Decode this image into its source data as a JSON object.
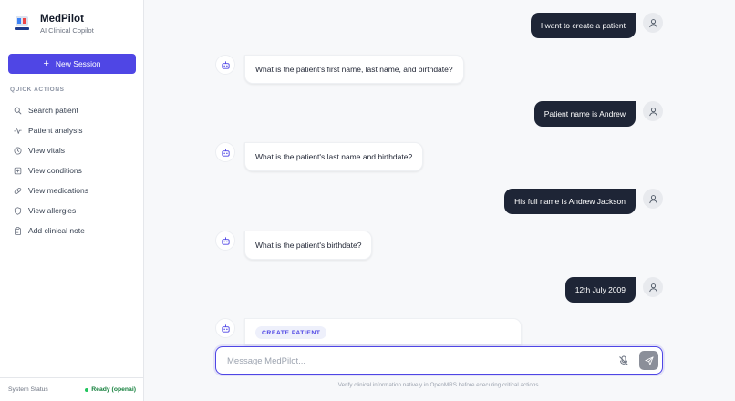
{
  "brand": {
    "title": "MedPilot",
    "subtitle": "AI Clinical Copilot",
    "logo_text": "MedPilot"
  },
  "new_session": {
    "label": "New Session"
  },
  "quick_actions": {
    "title": "QUICK ACTIONS",
    "items": [
      {
        "label": "Search patient",
        "icon": "search-icon"
      },
      {
        "label": "Patient analysis",
        "icon": "activity-icon"
      },
      {
        "label": "View vitals",
        "icon": "vitals-icon"
      },
      {
        "label": "View conditions",
        "icon": "conditions-icon"
      },
      {
        "label": "View medications",
        "icon": "pill-icon"
      },
      {
        "label": "View allergies",
        "icon": "shield-icon"
      },
      {
        "label": "Add clinical note",
        "icon": "clipboard-icon"
      }
    ]
  },
  "status": {
    "label": "System Status",
    "value": "Ready (openai)",
    "color": "#15803d"
  },
  "messages": [
    {
      "role": "user",
      "text": "I want to create a patient"
    },
    {
      "role": "assistant",
      "text": "What is the patient's first name, last name, and birthdate?"
    },
    {
      "role": "user",
      "text": "Patient name is Andrew"
    },
    {
      "role": "assistant",
      "text": "What is the patient's last name and birthdate?"
    },
    {
      "role": "user",
      "text": "His full name is Andrew Jackson"
    },
    {
      "role": "assistant",
      "text": "What is the patient's birthdate?"
    },
    {
      "role": "user",
      "text": "12th July 2009"
    }
  ],
  "action_card": {
    "chip": "CREATE PATIENT"
  },
  "composer": {
    "placeholder": "Message MedPilot...",
    "value": ""
  },
  "disclaimer": "Verify clinical information natively in OpenMRS before executing critical actions.",
  "colors": {
    "accent": "#4f46e5",
    "user_bubble": "#1e2536",
    "background": "#f7f8fa"
  }
}
